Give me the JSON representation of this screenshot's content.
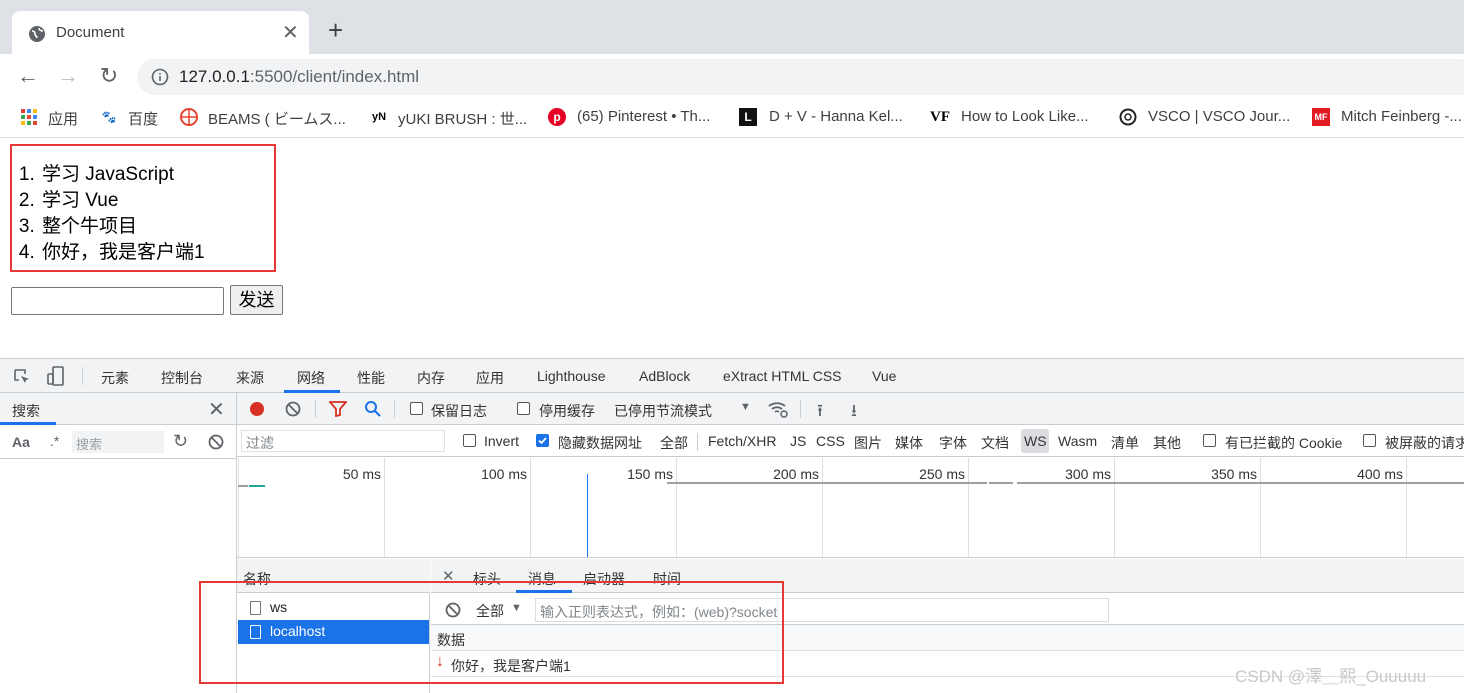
{
  "browser": {
    "tab_title": "Document",
    "url_host": "127.0.0.1",
    "url_rest": ":5500/client/index.html",
    "bookmarks": [
      {
        "icon": "apps-icon",
        "label": "应用"
      },
      {
        "icon": "baidu-icon",
        "label": "百度"
      },
      {
        "icon": "beams-icon",
        "label": "BEAMS ( ビームス..."
      },
      {
        "icon": "yukibrush-icon",
        "label": "yUKI BRUSH : 世..."
      },
      {
        "icon": "pinterest-icon",
        "label": "(65) Pinterest • Th..."
      },
      {
        "icon": "l-icon",
        "label": "D + V - Hanna Kel..."
      },
      {
        "icon": "vf-icon",
        "label": "How to Look Like..."
      },
      {
        "icon": "vsco-icon",
        "label": "VSCO | VSCO Jour..."
      },
      {
        "icon": "mf-icon",
        "label": "Mitch Feinberg -..."
      }
    ]
  },
  "page": {
    "todos": [
      "学习 JavaScript",
      "学习 Vue",
      "整个牛项目",
      "你好，我是客户端1"
    ],
    "send_label": "发送"
  },
  "devtools": {
    "tabs": [
      "元素",
      "控制台",
      "来源",
      "网络",
      "性能",
      "内存",
      "应用",
      "Lighthouse",
      "AdBlock",
      "eXtract HTML CSS",
      "Vue"
    ],
    "search": {
      "title": "搜索",
      "aa": "Aa",
      "regex": ".*",
      "placeholder": "搜索"
    },
    "toolbar": {
      "preserve_log": "保留日志",
      "disable_cache": "停用缓存",
      "throttle": "已停用节流模式"
    },
    "filter": {
      "placeholder": "过滤",
      "invert": "Invert",
      "hide_data_urls": "隐藏数据网址",
      "types": [
        "全部",
        "Fetch/XHR",
        "JS",
        "CSS",
        "图片",
        "媒体",
        "字体",
        "文档",
        "WS",
        "Wasm",
        "清单",
        "其他"
      ],
      "blocked_cookies": "有已拦截的 Cookie",
      "blocked_requests": "被屏蔽的请求"
    },
    "timeline_ticks": [
      "50 ms",
      "100 ms",
      "150 ms",
      "200 ms",
      "250 ms",
      "300 ms",
      "350 ms",
      "400 ms"
    ],
    "requests_header": "名称",
    "requests": [
      "ws",
      "localhost"
    ],
    "detail_tabs": [
      "标头",
      "消息",
      "启动器",
      "时间"
    ],
    "message_filter_select": "全部",
    "message_filter_placeholder": "输入正则表达式，例如：(web)?socket",
    "data_header": "数据",
    "messages": [
      {
        "direction": "down",
        "text": "你好，我是客户端1"
      }
    ]
  },
  "watermark": "CSDN @澤＿熙_Ouuuuu",
  "colors": {
    "accent": "#1a73e8",
    "highlight": "#e53935",
    "record": "#d93025"
  }
}
